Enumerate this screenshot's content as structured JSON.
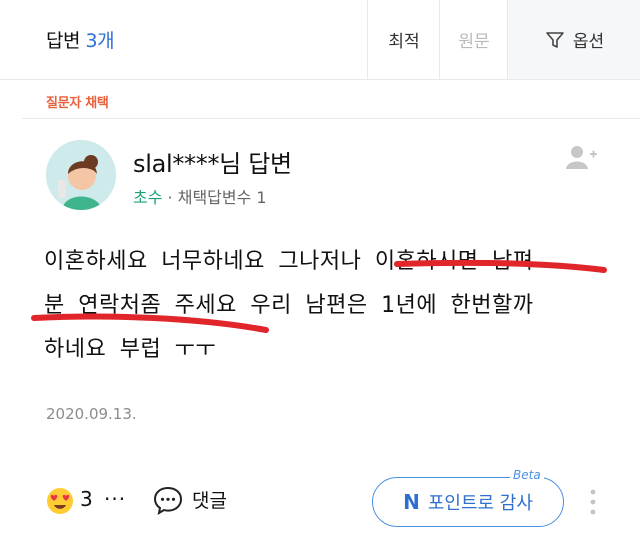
{
  "header": {
    "answers_label": "답변",
    "answers_count": "3개",
    "sort_best": "최적",
    "sort_original": "원문",
    "options": "옵션"
  },
  "answer": {
    "choice_badge": "질문자 채택",
    "author": "slal****님 답변",
    "rank": "초수",
    "adopted_stat": "· 채택답변수 1",
    "body_lines": [
      "이혼하세요  너무하네요  그나저나  이혼하시면  남펴",
      "분  연락처좀  주세요  우리  남편은  1년에  한번할까",
      "하네요  부럽 ㅜㅜ"
    ],
    "date": "2020.09.13.",
    "reaction_count": "3",
    "more_reactions": "···",
    "comment_label": "댓글",
    "point_button": "포인트로 감사",
    "point_icon": "N",
    "beta_label": "Beta"
  },
  "colors": {
    "accent_blue": "#2e6fd8",
    "choice_orange": "#e9603b",
    "rank_green": "#19a37a",
    "underline_red": "#e0262b"
  }
}
